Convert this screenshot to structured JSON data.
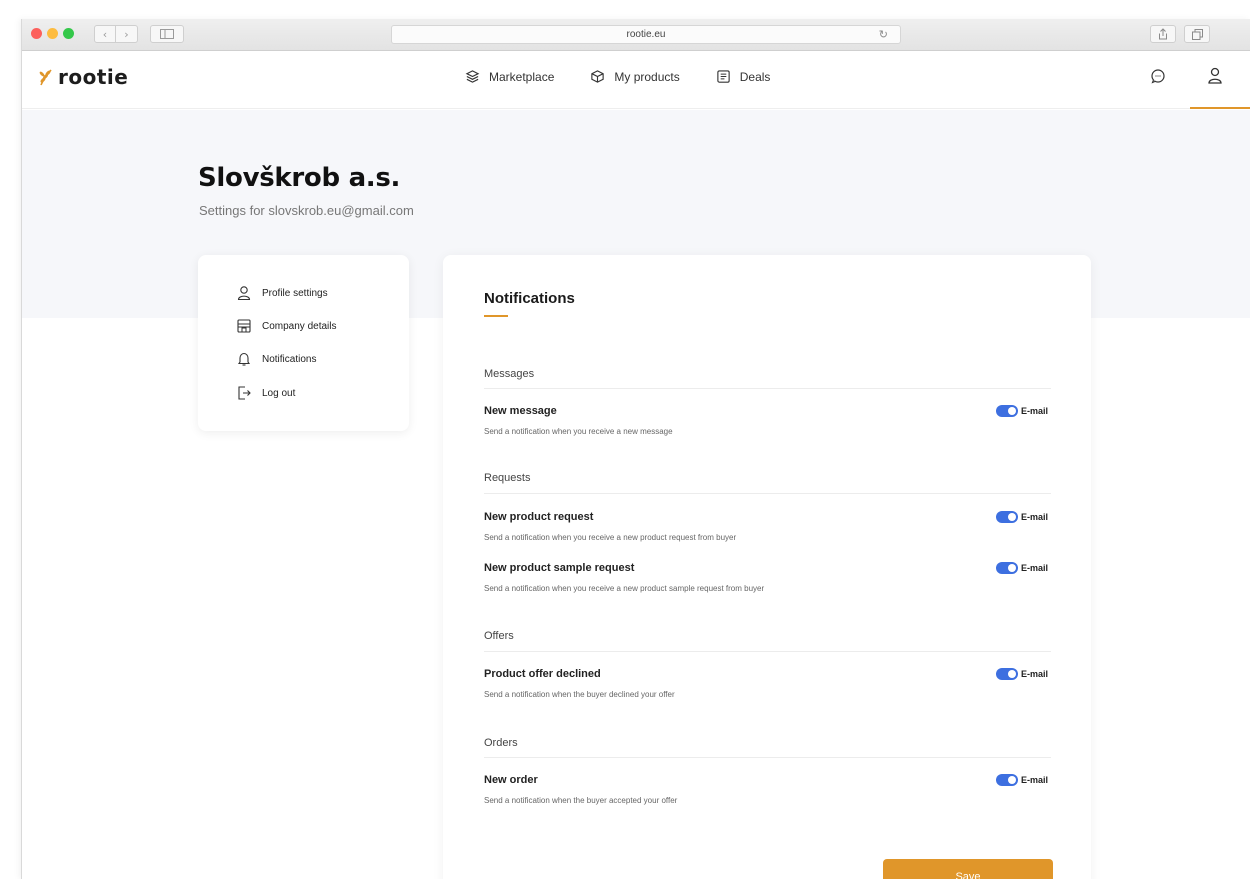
{
  "browser": {
    "url": "rootie.eu",
    "back_glyph": "‹",
    "forward_glyph": "›",
    "reload_glyph": "↻"
  },
  "app": {
    "logo_text": "rootie",
    "nav": [
      {
        "label": "Marketplace",
        "icon": "layers-icon"
      },
      {
        "label": "My products",
        "icon": "box-icon"
      },
      {
        "label": "Deals",
        "icon": "document-icon"
      }
    ],
    "accent_color": "#e0962a",
    "toggle_color": "#3d6fe0"
  },
  "company": {
    "name": "Slovškrob a.s.",
    "subtitle": "Settings for slovskrob.eu@gmail.com"
  },
  "side_menu": [
    {
      "label": "Profile settings",
      "icon": "user-icon"
    },
    {
      "label": "Company details",
      "icon": "store-icon"
    },
    {
      "label": "Notifications",
      "icon": "bell-icon"
    },
    {
      "label": "Log out",
      "icon": "logout-icon"
    }
  ],
  "notifications": {
    "title": "Notifications",
    "sections": [
      {
        "title": "Messages",
        "rows": [
          {
            "title": "New message",
            "desc": "Send a notification when you receive a new message",
            "toggle_label": "E-mail",
            "enabled": true
          }
        ]
      },
      {
        "title": "Requests",
        "rows": [
          {
            "title": "New product request",
            "desc": "Send a notification when you receive a new product request from buyer",
            "toggle_label": "E-mail",
            "enabled": true
          },
          {
            "title": "New product sample request",
            "desc": "Send a notification when you receive a new product sample request from buyer",
            "toggle_label": "E-mail",
            "enabled": true
          }
        ]
      },
      {
        "title": "Offers",
        "rows": [
          {
            "title": "Product offer declined",
            "desc": "Send a notification when the buyer declined your offer",
            "toggle_label": "E-mail",
            "enabled": true
          }
        ]
      },
      {
        "title": "Orders",
        "rows": [
          {
            "title": "New order",
            "desc": "Send a notification when the buyer accepted your offer",
            "toggle_label": "E-mail",
            "enabled": true
          }
        ]
      }
    ],
    "save_label": "Save"
  }
}
